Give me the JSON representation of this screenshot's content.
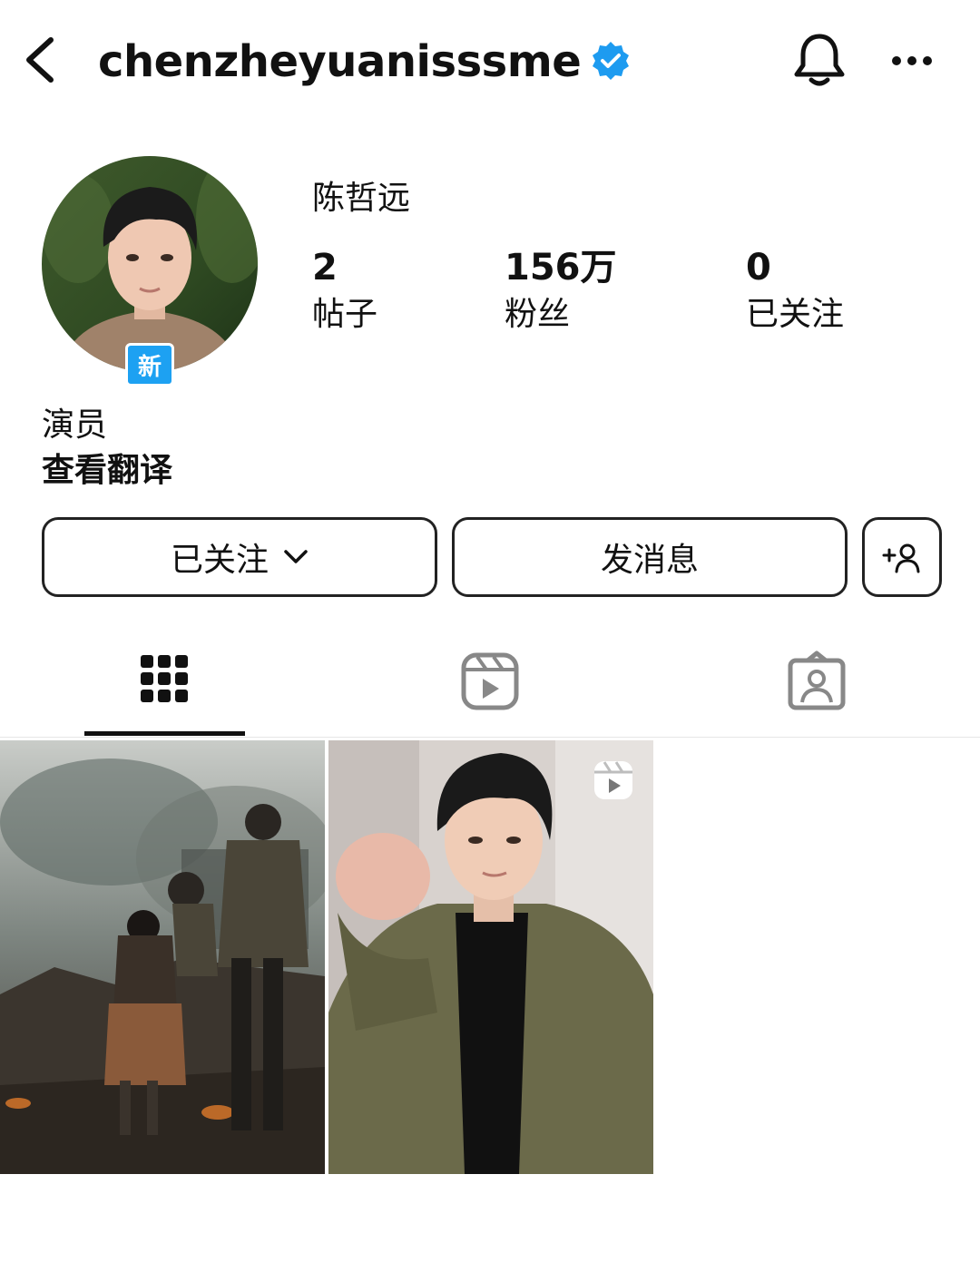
{
  "header": {
    "username": "chenzheyuanisssme",
    "icons": [
      "back-arrow-icon",
      "verified-badge-icon",
      "bell-icon",
      "more-icon"
    ]
  },
  "profile": {
    "avatar_badge": "新",
    "display_name": "陈哲远",
    "stats": {
      "posts": {
        "value": "2",
        "label": "帖子"
      },
      "followers": {
        "value": "156万",
        "label": "粉丝"
      },
      "following": {
        "value": "0",
        "label": "已关注"
      }
    },
    "bio": "演员",
    "translate_link": "查看翻译"
  },
  "actions": {
    "follow_label": "已关注",
    "message_label": "发消息",
    "icons": [
      "chevron-down-icon",
      "add-user-icon"
    ]
  },
  "tabs": [
    "grid-icon",
    "reels-icon",
    "tagged-icon"
  ],
  "colors": {
    "verified": "#1d9bf0",
    "new_badge": "#1da1f2",
    "text": "#111111"
  }
}
